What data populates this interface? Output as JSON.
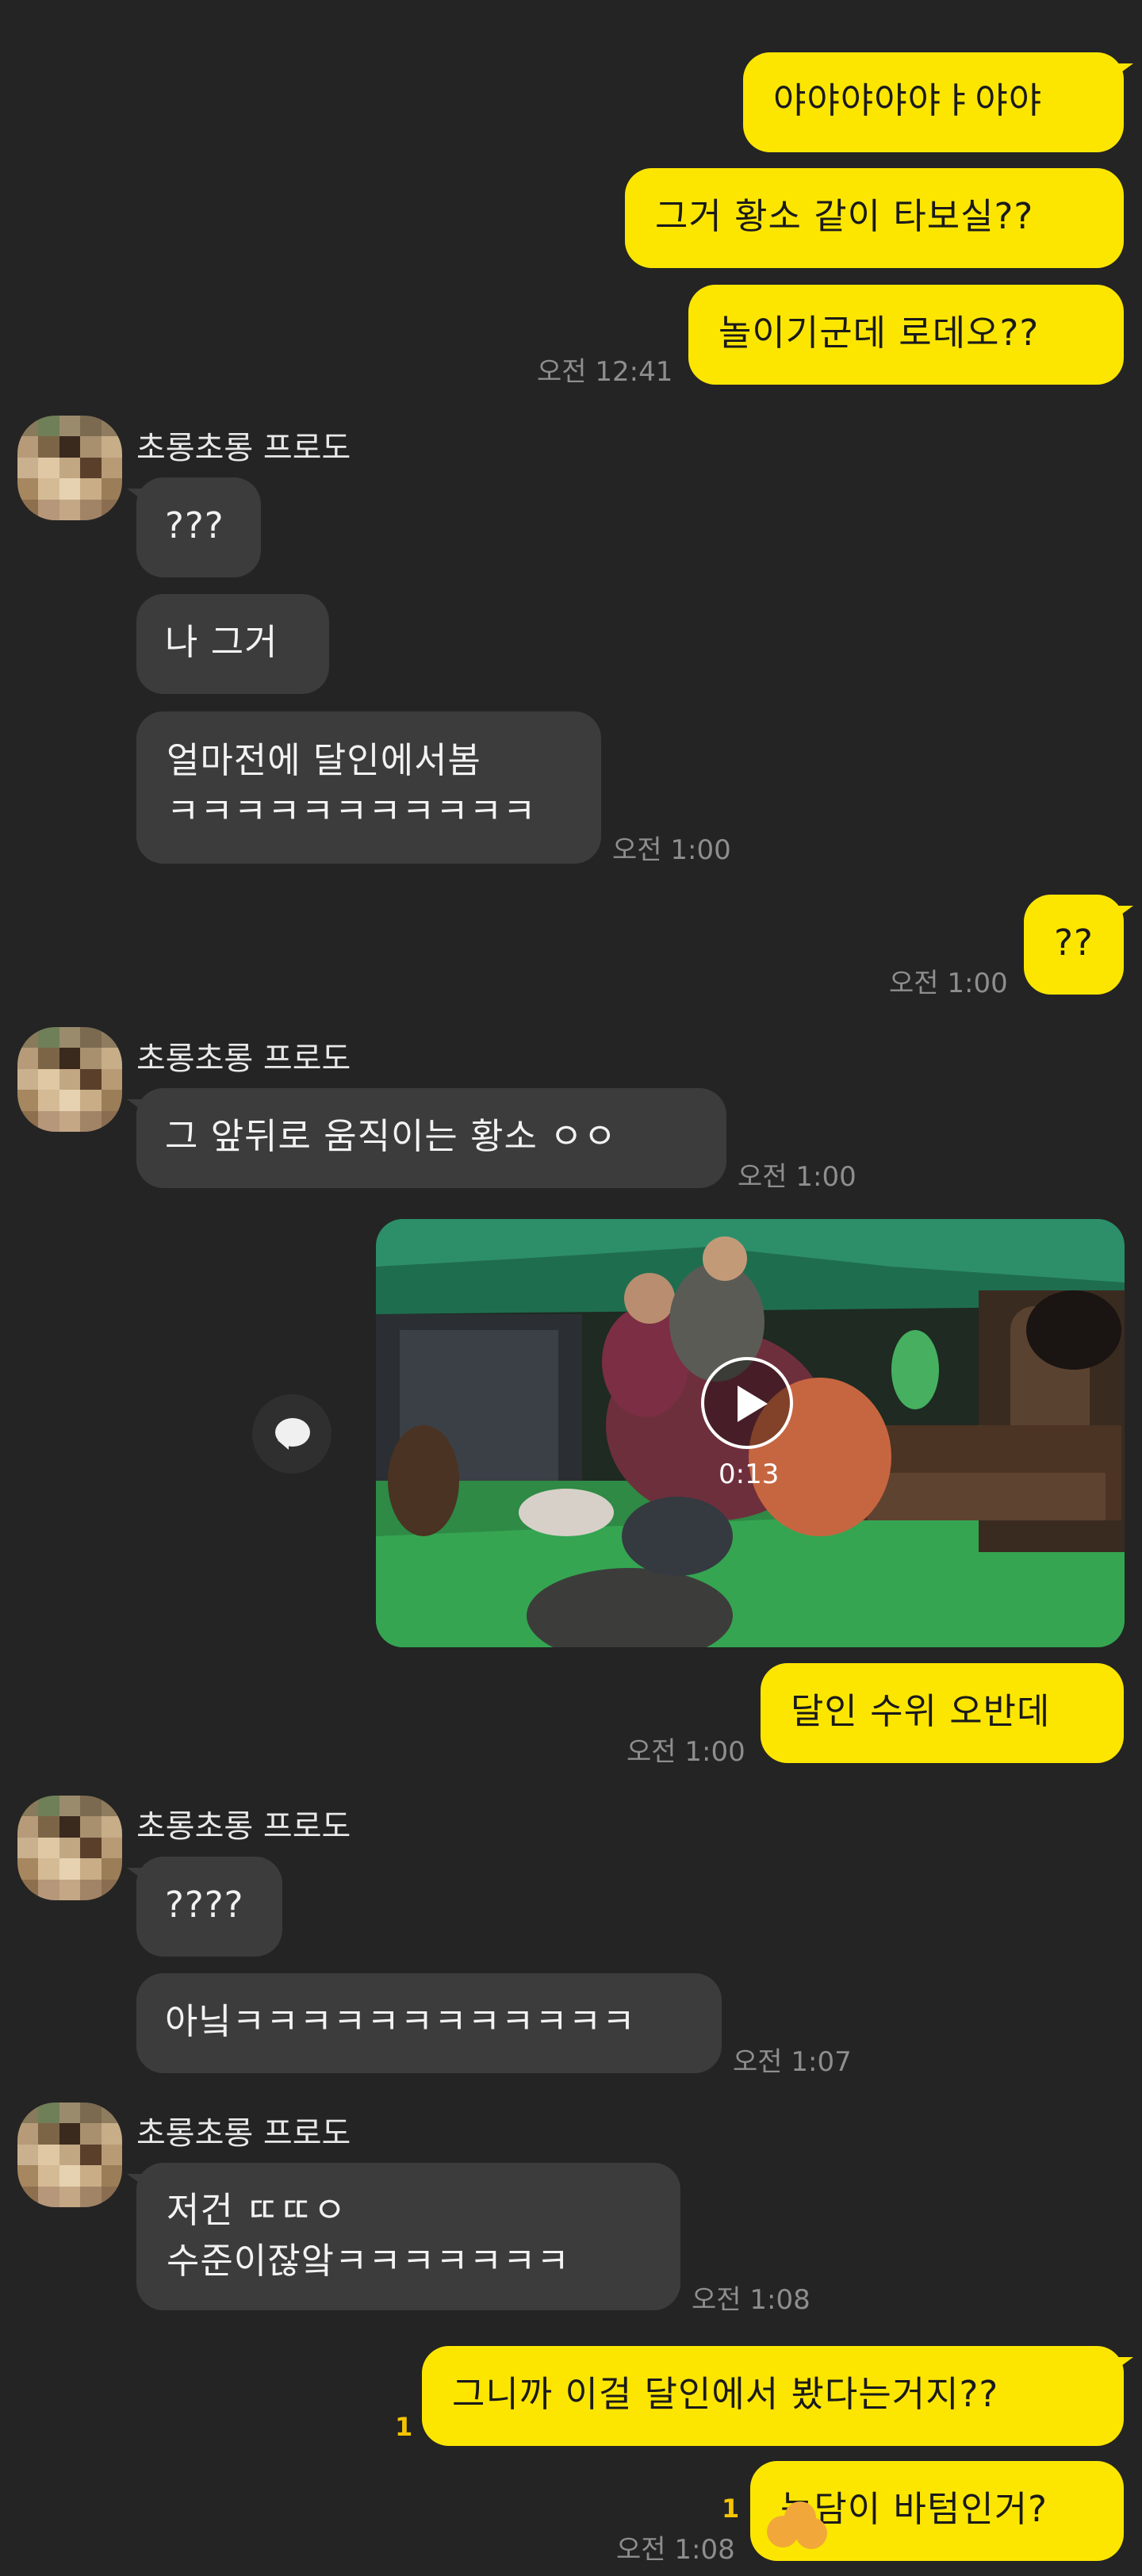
{
  "contact_name": "초롱초롱 프로도",
  "messages": {
    "m1": "야야야야야ㅑ야야",
    "m2": "그거 황소 같이 타보실??",
    "m3": "놀이기군데 로데오??",
    "t1": "오전 12:41",
    "r1": "???",
    "r2": "나 그거",
    "r3": "얼마전에 달인에서봄\nㅋㅋㅋㅋㅋㅋㅋㅋㅋㅋㅋ",
    "t2": "오전 1:00",
    "m4": "??",
    "t3": "오전 1:00",
    "r4": "그 앞뒤로 움직이는 황소 ㅇㅇ",
    "t4": "오전 1:00",
    "video_duration": "0:13",
    "m5": "달인 수위 오반데",
    "t5": "오전 1:00",
    "r5": "????",
    "r6": "아닠ㅋㅋㅋㅋㅋㅋㅋㅋㅋㅋㅋㅋ",
    "t6": "오전 1:07",
    "r7": "저건 ㄸㄸㅇ\n수준이잖앜ㅋㅋㅋㅋㅋㅋㅋ",
    "t7": "오전 1:08",
    "m6": "그니까 이걸 달인에서 봤다는거지??",
    "m6_unread": "1",
    "m7": "농담이 바텀인거?",
    "m7_unread": "1",
    "t8": "오전 1:08"
  },
  "colors": {
    "background": "#242424",
    "my_bubble": "#FCE600",
    "their_bubble": "#3C3C3C",
    "unread_count": "#F5C400"
  },
  "icons": {
    "share": "speech-bubble-icon",
    "play": "play-icon"
  }
}
